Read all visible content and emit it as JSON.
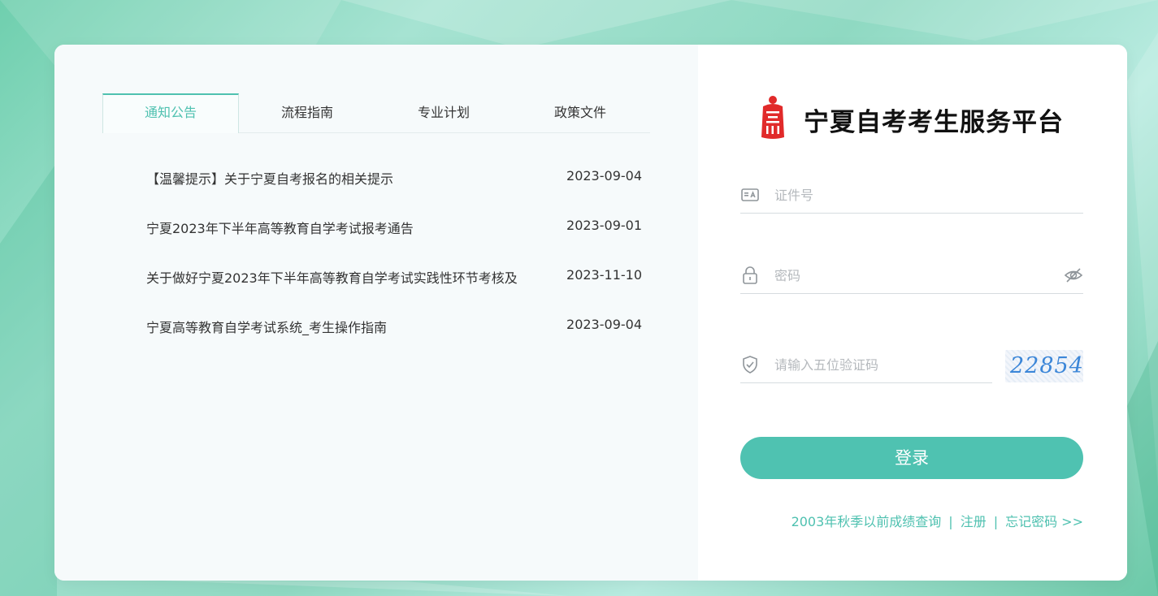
{
  "tabs": [
    {
      "label": "通知公告"
    },
    {
      "label": "流程指南"
    },
    {
      "label": "专业计划"
    },
    {
      "label": "政策文件"
    }
  ],
  "news": [
    {
      "title": "【温馨提示】关于宁夏自考报名的相关提示",
      "date": "2023-09-04"
    },
    {
      "title": "宁夏2023年下半年高等教育自学考试报考通告",
      "date": "2023-09-01"
    },
    {
      "title": "关于做好宁夏2023年下半年高等教育自学考试实践性环节考核及",
      "date": "2023-11-10"
    },
    {
      "title": "宁夏高等教育自学考试系统_考生操作指南",
      "date": "2023-09-04"
    }
  ],
  "brand": {
    "title": "宁夏自考考生服务平台",
    "seal_color": "#e12a2a"
  },
  "form": {
    "id_placeholder": "证件号",
    "password_placeholder": "密码",
    "captcha_placeholder": "请输入五位验证码",
    "captcha_code": "22854",
    "login_label": "登录"
  },
  "links": {
    "query": "2003年秋季以前成绩查询",
    "separator": "|",
    "register": "注册",
    "forgot": "忘记密码 >>"
  },
  "colors": {
    "accent": "#4fc2b1",
    "text": "#333333",
    "placeholder": "#b5b9bd"
  }
}
